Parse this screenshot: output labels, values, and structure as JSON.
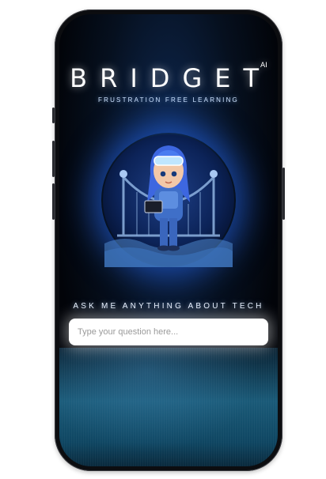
{
  "app": {
    "title": "BRIDGET",
    "trademark": "AI",
    "tagline": "FRUSTRATION FREE LEARNING"
  },
  "mascot": {
    "icon": "robot-girl-avatar-icon"
  },
  "question": {
    "prompt": "ASK ME ANYTHING ABOUT TECH",
    "placeholder": "Type your question here...",
    "value": ""
  },
  "colors": {
    "glow": "#2a6bff",
    "floor": "#1a5a78",
    "background": "#020409"
  }
}
